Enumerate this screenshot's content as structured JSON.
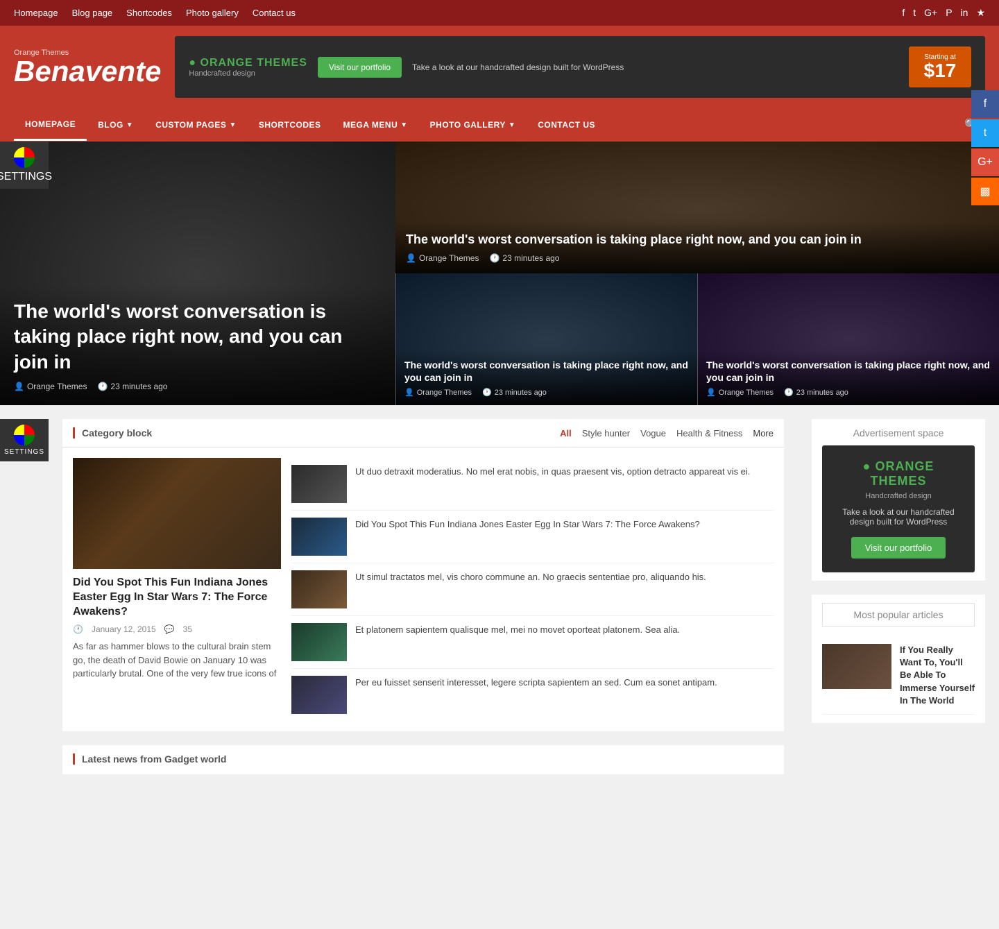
{
  "topNav": {
    "links": [
      "Homepage",
      "Blog page",
      "Shortcodes",
      "Photo gallery",
      "Contact us"
    ],
    "icons": [
      "f",
      "t",
      "g+",
      "p",
      "in",
      "rss"
    ]
  },
  "header": {
    "logoSubtitle": "Orange Themes",
    "logoTitle": "Benavente",
    "banner": {
      "logoTitle": "ORANGE THEMES",
      "logoSubtitle": "Handcrafted design",
      "buttonText": "Visit our portfolio",
      "description": "Take a look at our handcrafted design built for WordPress",
      "priceLabel": "Starting at",
      "priceValue": "$17"
    }
  },
  "mainNav": {
    "items": [
      {
        "label": "HOMEPAGE",
        "active": true
      },
      {
        "label": "BLOG",
        "hasDropdown": true
      },
      {
        "label": "CUSTOM PAGES",
        "hasDropdown": true
      },
      {
        "label": "SHORTCODES"
      },
      {
        "label": "MEGA MENU",
        "hasDropdown": true
      },
      {
        "label": "PHOTO GALLERY",
        "hasDropdown": true
      },
      {
        "label": "CONTACT US"
      }
    ]
  },
  "hero": {
    "mainArticle": {
      "title": "The world's worst conversation is taking place right now, and you can join in",
      "author": "Orange Themes",
      "time": "23 minutes ago"
    },
    "topArticle": {
      "title": "The world's worst conversation is taking place right now, and you can join in",
      "author": "Orange Themes",
      "time": "23 minutes ago"
    },
    "bottomArticles": [
      {
        "title": "The world's worst conversation is taking place right now, and you can join in",
        "author": "Orange Themes",
        "time": "23 minutes ago"
      },
      {
        "title": "The world's worst conversation is taking place right now, and you can join in",
        "author": "Orange Themes",
        "time": "23 minutes ago"
      }
    ]
  },
  "settings": {
    "label": "SETTINGS"
  },
  "categoryBlock": {
    "title": "Category block",
    "tabs": {
      "all": "All",
      "styleHunter": "Style hunter",
      "vogue": "Vogue",
      "healthFitness": "Health & Fitness",
      "more": "More"
    },
    "featuredArticle": {
      "title": "Did You Spot This Fun Indiana Jones Easter Egg In Star Wars 7: The Force Awakens?",
      "date": "January 12, 2015",
      "comments": "35",
      "excerpt": "As far as hammer blows to the cultural brain stem go, the death of David Bowie on January 10 was particularly brutal. One of the very few true icons of"
    },
    "articleList": [
      {
        "text": "Ut duo detraxit moderatius. No mel erat nobis, in quas praesent vis, option detracto appareat vis ei.",
        "thumbClass": "thumb-car"
      },
      {
        "text": "Did You Spot This Fun Indiana Jones Easter Egg In Star Wars 7: The Force Awakens?",
        "thumbClass": "thumb-game"
      },
      {
        "text": "Ut simul tractatos mel, vis choro commune an. No graecis sententiae pro, aliquando his.",
        "thumbClass": "thumb-hands"
      },
      {
        "text": "Et platonem sapientem qualisque mel, mei no movet oporteat platonem. Sea alia.",
        "thumbClass": "thumb-tablet"
      },
      {
        "text": "Per eu fuisset senserit interesset, legere scripta sapientem an sed. Cum ea sonet antipam.",
        "thumbClass": "thumb-drone"
      }
    ]
  },
  "latestNews": {
    "title": "Latest news from Gadget world"
  },
  "sidebar": {
    "adSpace": {
      "title": "Advertisement space",
      "banner": {
        "logoTitle": "ORANGE THEMES",
        "logoSubtitle": "Handcrafted design",
        "description": "Take a look at our handcrafted design built for WordPress",
        "buttonText": "Visit our portfolio"
      }
    },
    "mostPopular": {
      "title": "Most popular articles",
      "items": [
        {
          "title": "If You Really Want To, You'll Be Able To Immerse Yourself In The World",
          "thumbClass": "thumb-moto"
        }
      ]
    }
  },
  "social": {
    "buttons": [
      "f",
      "t",
      "g+",
      "rss"
    ]
  }
}
